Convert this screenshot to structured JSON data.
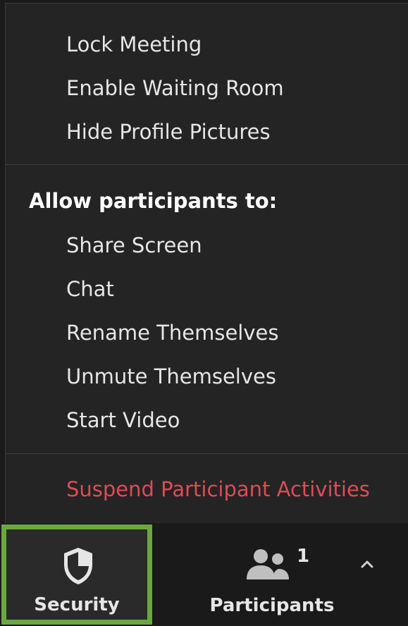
{
  "security_menu": {
    "items": [
      {
        "label": "Lock Meeting"
      },
      {
        "label": "Enable Waiting Room"
      },
      {
        "label": "Hide Profile Pictures"
      }
    ],
    "allow_heading": "Allow participants to:",
    "allow_items": [
      {
        "label": "Share Screen"
      },
      {
        "label": "Chat"
      },
      {
        "label": "Rename Themselves"
      },
      {
        "label": "Unmute Themselves"
      },
      {
        "label": "Start Video"
      }
    ],
    "suspend_label": "Suspend Participant Activities"
  },
  "toolbar": {
    "security_label": "Security",
    "participants_label": "Participants",
    "participants_count": "1",
    "security_icon": "shield-icon",
    "participants_icon": "people-icon",
    "caret_icon": "chevron-up-icon"
  },
  "colors": {
    "danger": "#e04b55",
    "highlight": "#6aa83f"
  }
}
